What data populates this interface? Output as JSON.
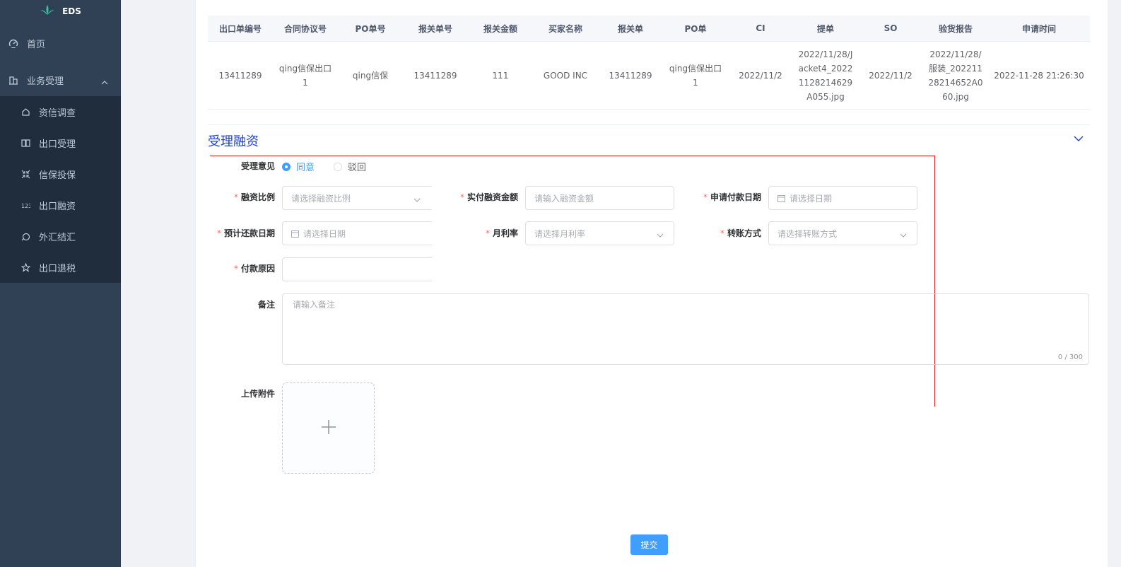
{
  "colors": {
    "sidebar_bg": "#304156",
    "submenu_bg": "#1f2d3d",
    "accent": "#409eff",
    "required": "#f56c6c",
    "section_title": "#1f3fd1",
    "highlight_box": "#e02020"
  },
  "sidebar": {
    "logo_text": "EDS",
    "logo_icon": "leaf-logo-icon",
    "home": {
      "label": "首页",
      "icon": "dashboard-icon"
    },
    "business": {
      "label": "业务受理",
      "icon": "business-icon",
      "expanded": true
    },
    "sub_items": [
      {
        "label": "资信调查",
        "icon": "home-icon"
      },
      {
        "label": "出口受理",
        "icon": "book-icon"
      },
      {
        "label": "信保投保",
        "icon": "shrink-icon"
      },
      {
        "label": "出口融资",
        "icon": "number-icon"
      },
      {
        "label": "外汇结汇",
        "icon": "exchange-icon"
      },
      {
        "label": "出口退税",
        "icon": "star-icon"
      }
    ]
  },
  "table": {
    "headers": [
      "出口单编号",
      "合同协议号",
      "PO单号",
      "报关单号",
      "报关金额",
      "买家名称",
      "报关单",
      "PO单",
      "CI",
      "提单",
      "SO",
      "验货报告",
      "申请时间"
    ],
    "row": [
      "13411289",
      "qing信保出口1",
      "qing信保",
      "13411289",
      "111",
      "GOOD INC",
      "13411289",
      "qing信保出口1",
      "2022/11/2",
      "2022/11/28/Jacket4_20221128214629A055.jpg",
      "2022/11/2",
      "2022/11/28/服装_20221128214652A060.jpg",
      "2022-11-28 21:26:30"
    ]
  },
  "section": {
    "title": "受理融资"
  },
  "form": {
    "opinion": {
      "label": "受理意见",
      "options": [
        "同意",
        "驳回"
      ],
      "selected": "同意"
    },
    "ratio": {
      "label": "融资比例",
      "placeholder": "请选择融资比例"
    },
    "amount": {
      "label": "实付融资金额",
      "placeholder": "请输入融资金额"
    },
    "pay_date": {
      "label": "申请付款日期",
      "placeholder": "请选择日期"
    },
    "repay_date": {
      "label": "预计还款日期",
      "placeholder": "请选择日期"
    },
    "rate": {
      "label": "月利率",
      "placeholder": "请选择月利率"
    },
    "transfer": {
      "label": "转账方式",
      "placeholder": "请选择转账方式"
    },
    "reason": {
      "label": "付款原因",
      "value": ""
    },
    "remark": {
      "label": "备注",
      "placeholder": "请输入备注",
      "counter": "0 / 300"
    },
    "upload": {
      "label": "上传附件"
    }
  },
  "submit_label": "提交"
}
